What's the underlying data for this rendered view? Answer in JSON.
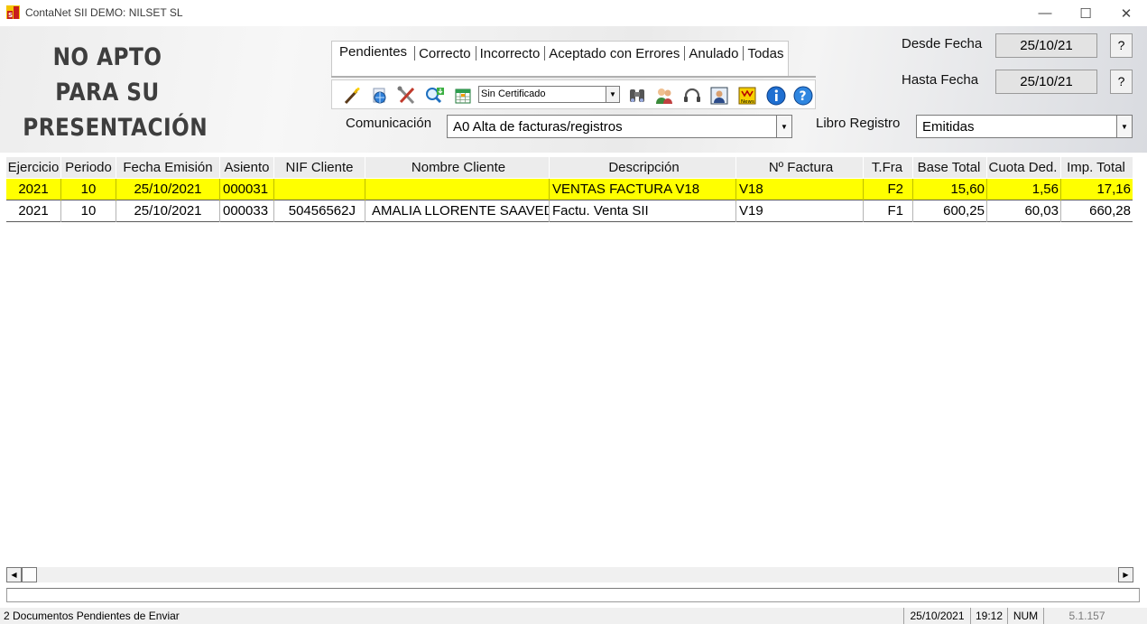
{
  "window": {
    "title": "ContaNet SII DEMO: NILSET SL",
    "minimize": "—",
    "maximize": "☐",
    "close": "✕"
  },
  "watermark_lines": [
    "NO APTO",
    "PARA SU",
    "PRESENTACIÓN"
  ],
  "tabs": [
    "Pendientes",
    "Correcto",
    "Incorrecto",
    "Aceptado con Errores",
    "Anulado",
    "Todas"
  ],
  "active_tab": "Pendientes",
  "toolbar": {
    "certificate_value": "Sin Certificado",
    "icons": [
      "wand-icon",
      "globe-icon",
      "tools-icon",
      "search-download-icon",
      "calendar-grid-icon",
      "certificate-select",
      "binoculars-icon",
      "users-icon",
      "headset-icon",
      "portrait-icon",
      "news-icon",
      "info-icon",
      "help-icon"
    ]
  },
  "filters": {
    "comunicacion_label": "Comunicación",
    "comunicacion_value": "A0 Alta de facturas/registros",
    "libro_label": "Libro Registro",
    "libro_value": "Emitidas",
    "desde_label": "Desde Fecha",
    "desde_value": "25/10/21",
    "hasta_label": "Hasta Fecha",
    "hasta_value": "25/10/21",
    "help_button": "?"
  },
  "table": {
    "columns": [
      "Ejercicio",
      "Periodo",
      "Fecha Emisión",
      "Asiento",
      "NIF Cliente",
      "Nombre Cliente",
      "Descripción",
      "Nº Factura",
      "T.Fra",
      "Base Total",
      "Cuota Ded.",
      "Imp. Total"
    ],
    "rows": [
      [
        "2021",
        "10",
        "25/10/2021",
        "000031",
        "",
        "",
        "VENTAS FACTURA V18",
        "V18",
        "F2",
        "15,60",
        "1,56",
        "17,16"
      ],
      [
        "2021",
        "10",
        "25/10/2021",
        "000033",
        "50456562J",
        "AMALIA LLORENTE SAAVED",
        "Factu. Venta SII",
        "V19",
        "F1",
        "600,25",
        "60,03",
        "660,28"
      ]
    ],
    "selected_row": 0,
    "selected_color": "#ffff00"
  },
  "statusbar": {
    "message": "2 Documentos Pendientes de Enviar",
    "date": "25/10/2021",
    "time": "19:12",
    "num": "NUM",
    "version": "5.1.157"
  },
  "colors": {
    "logo_red": "#c81e1e",
    "logo_yellow": "#f5c400",
    "info_blue": "#1f6fd1"
  }
}
